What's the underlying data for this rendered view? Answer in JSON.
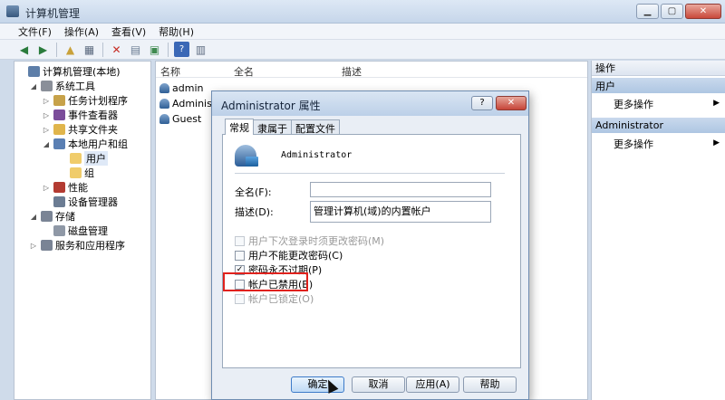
{
  "window": {
    "title": "计算机管理"
  },
  "menu": [
    "文件(F)",
    "操作(A)",
    "查看(V)",
    "帮助(H)"
  ],
  "tree": [
    {
      "label": "计算机管理(本地)",
      "indent": 0,
      "exp": "",
      "icon_color": "#5d7ea8"
    },
    {
      "label": "系统工具",
      "indent": 1,
      "exp": "◢",
      "icon_color": "#8a8f99"
    },
    {
      "label": "任务计划程序",
      "indent": 2,
      "exp": "▷",
      "icon_color": "#c7a24a"
    },
    {
      "label": "事件查看器",
      "indent": 2,
      "exp": "▷",
      "icon_color": "#7b4d9a"
    },
    {
      "label": "共享文件夹",
      "indent": 2,
      "exp": "▷",
      "icon_color": "#e0b54c"
    },
    {
      "label": "本地用户和组",
      "indent": 2,
      "exp": "◢",
      "icon_color": "#5a7fb3"
    },
    {
      "label": "用户",
      "indent": 3,
      "exp": "",
      "icon_color": "#f0cc6b",
      "selected": true
    },
    {
      "label": "组",
      "indent": 3,
      "exp": "",
      "icon_color": "#f0cc6b"
    },
    {
      "label": "性能",
      "indent": 2,
      "exp": "▷",
      "icon_color": "#b33b32"
    },
    {
      "label": "设备管理器",
      "indent": 2,
      "exp": "",
      "icon_color": "#6b7c93"
    },
    {
      "label": "存储",
      "indent": 1,
      "exp": "◢",
      "icon_color": "#7a8495"
    },
    {
      "label": "磁盘管理",
      "indent": 2,
      "exp": "",
      "icon_color": "#8f98a6"
    },
    {
      "label": "服务和应用程序",
      "indent": 1,
      "exp": "▷",
      "icon_color": "#7a8495"
    }
  ],
  "list": {
    "columns": [
      "名称",
      "全名",
      "描述"
    ],
    "rows": [
      "admin",
      "Administr",
      "Guest"
    ]
  },
  "actions": {
    "header": "操作",
    "sections": [
      {
        "title": "用户",
        "item": "更多操作"
      },
      {
        "title": "Administrator",
        "item": "更多操作"
      }
    ]
  },
  "dialog": {
    "title": "Administrator 属性",
    "tabs": [
      "常规",
      "隶属于",
      "配置文件"
    ],
    "username": "Administrator",
    "fullname_label": "全名(F):",
    "fullname_value": "",
    "desc_label": "描述(D):",
    "desc_value": "管理计算机(域)的内置帐户",
    "checkboxes": [
      {
        "label": "用户下次登录时须更改密码(M)",
        "checked": false,
        "disabled": true
      },
      {
        "label": "用户不能更改密码(C)",
        "checked": false,
        "disabled": false
      },
      {
        "label": "密码永不过期(P)",
        "checked": true,
        "disabled": false
      },
      {
        "label": "帐户已禁用(B)",
        "checked": false,
        "disabled": false
      },
      {
        "label": "帐户已锁定(O)",
        "checked": false,
        "disabled": true
      }
    ],
    "buttons": [
      "确定",
      "取消",
      "应用(A)",
      "帮助"
    ]
  },
  "colors": {
    "highlight": "#e0211c",
    "selection": "#dfe9f7"
  }
}
